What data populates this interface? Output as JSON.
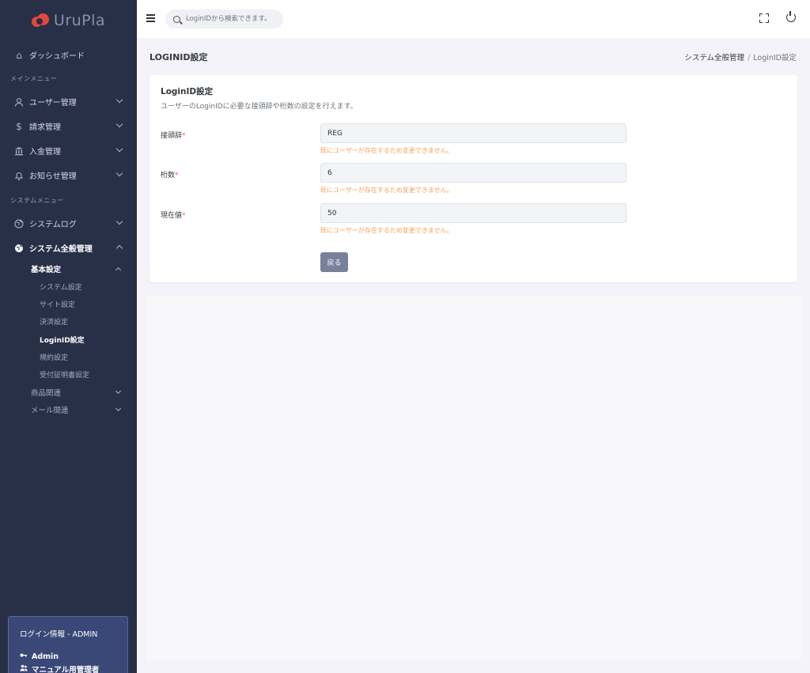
{
  "brand": {
    "name": "UruPla"
  },
  "topbar": {
    "search_placeholder": "LoginIDから検索できます。"
  },
  "sidebar": {
    "dashboard": "ダッシュボード",
    "main_menu_title": "メインメニュー",
    "main_items": [
      {
        "label": "ユーザー管理",
        "icon": "user-icon"
      },
      {
        "label": "請求管理",
        "icon": "dollar-icon"
      },
      {
        "label": "入金管理",
        "icon": "bank-icon"
      },
      {
        "label": "お知らせ管理",
        "icon": "bell-icon"
      }
    ],
    "system_menu_title": "システムメニュー",
    "system_log": "システムログ",
    "system_general": "システム全般管理",
    "basic_settings": "基本設定",
    "basic_sub": [
      "システム設定",
      "サイト設定",
      "決済設定",
      "LoginID設定",
      "規約設定",
      "受付証明書設定"
    ],
    "product_related": "商品関連",
    "mail_related": "メール関連",
    "login_info": {
      "title": "ログイン情報 - ADMIN",
      "user": "Admin",
      "role": "マニュアル用管理者"
    }
  },
  "page": {
    "title": "LOGINID設定",
    "breadcrumb": {
      "parent": "システム全般管理",
      "sep": "/",
      "current": "LoginID設定"
    }
  },
  "card": {
    "title": "LoginID設定",
    "description": "ユーザーのLoginIDに必要な接頭辞や桁数の設定を行えます。",
    "required_mark": "*",
    "fields": [
      {
        "label": "接頭辞",
        "value": "REG",
        "note": "既にユーザーが存在するため変更できません。"
      },
      {
        "label": "桁数",
        "value": "6",
        "note": "既にユーザーが存在するため変更できません。"
      },
      {
        "label": "現在値",
        "value": "50",
        "note": "既にユーザーが存在するため変更できません。"
      }
    ],
    "back_button": "戻る"
  },
  "colors": {
    "sidebar_bg": "#283048",
    "brand_red": "#e8453c",
    "note_orange": "#f7a35c",
    "button_gray": "#79809a",
    "required_red": "#f06548"
  }
}
